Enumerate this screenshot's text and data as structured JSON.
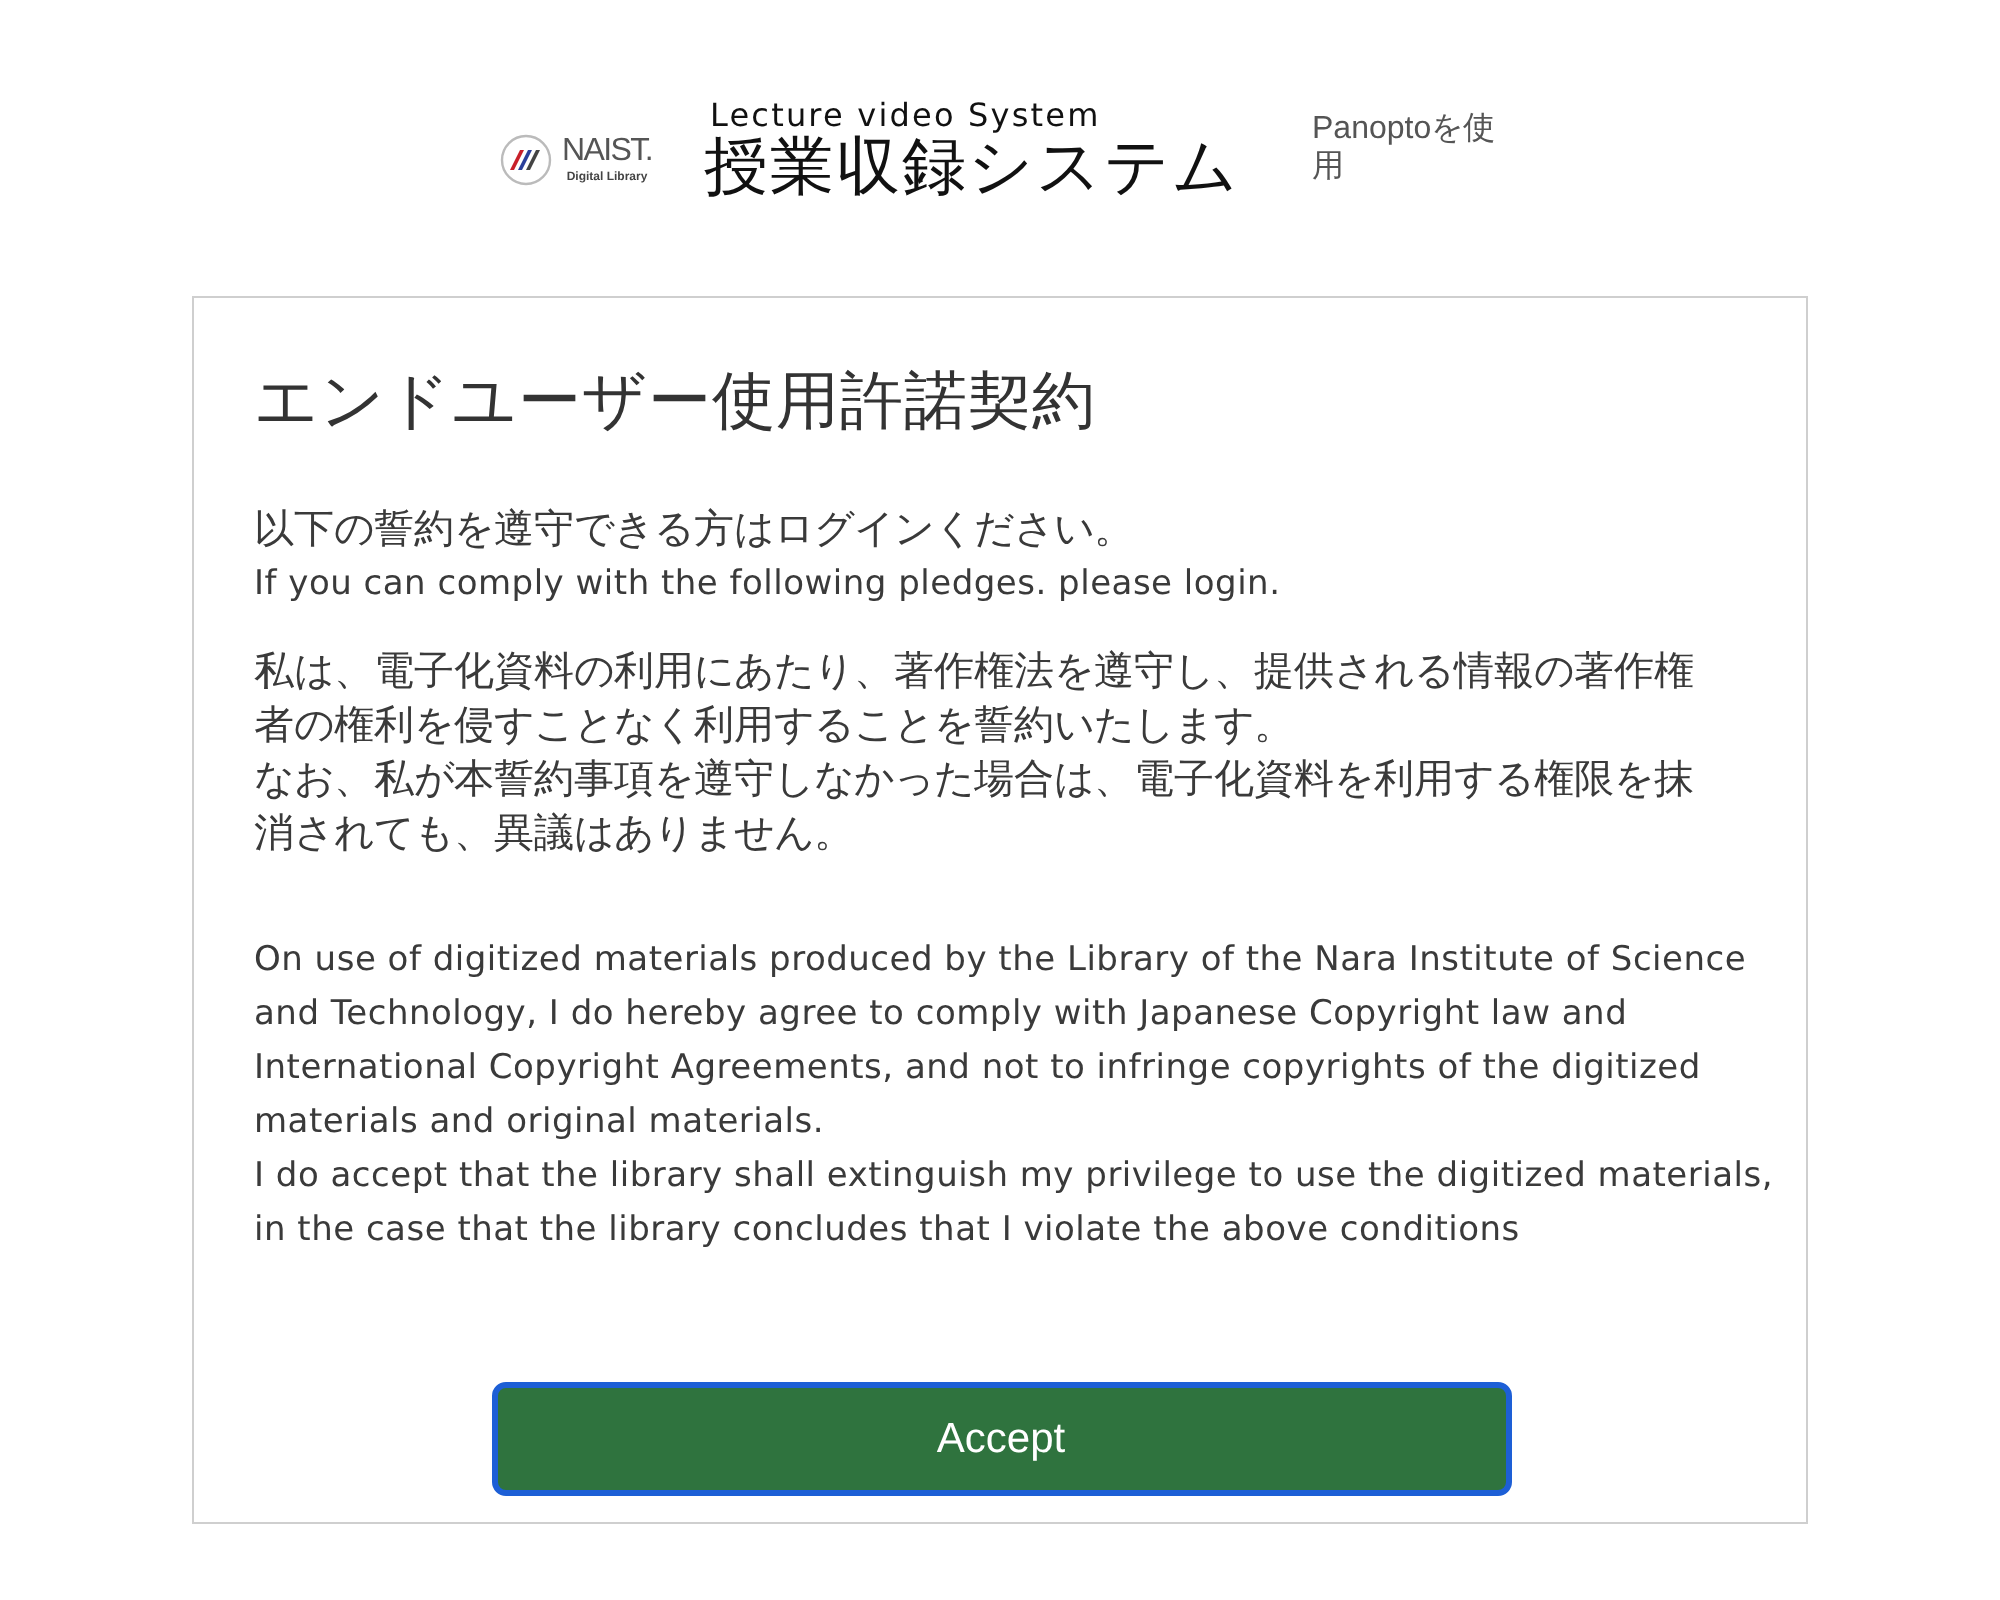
{
  "header": {
    "logo": {
      "name": "NAIST.",
      "subtitle": "Digital Library"
    },
    "system": {
      "tagline": "Lecture video System",
      "title": "授業収録システム"
    },
    "powered_by": "Panoptoを使用"
  },
  "agreement": {
    "title": "エンドユーザー使用許諾契約",
    "intro_ja": "以下の誓約を遵守できる方はログインください。",
    "intro_en": "If you can comply with the following pledges. please login.",
    "pledge_ja": [
      "私は、電子化資料の利用にあたり、著作権法を遵守し、提供される情報の著作権者の権利を侵すことなく利用することを誓約いたします。",
      "なお、私が本誓約事項を遵守しなかった場合は、電子化資料を利用する権限を抹消されても、異議はありません。"
    ],
    "pledge_en": [
      "On use of digitized materials produced by the Library of the Nara Institute of Science and Technology, I do hereby agree to comply with Japanese Copyright law and International Copyright Agreements, and not to infringe copyrights of the digitized materials and original materials.",
      "I do accept that the library shall extinguish my privilege to use the digitized materials, in the case that the library concludes that I violate the above conditions"
    ]
  },
  "accept_button": {
    "label": "Accept",
    "focused": true
  }
}
